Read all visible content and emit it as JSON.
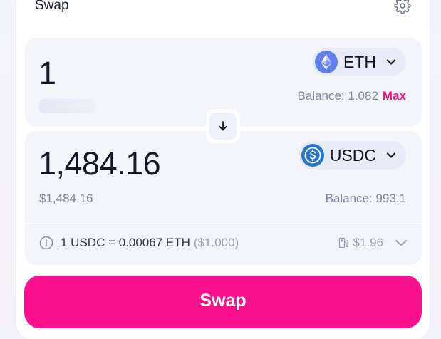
{
  "header": {
    "title": "Swap",
    "settings_icon": "gear-icon"
  },
  "sell": {
    "amount": "1",
    "token": "ETH",
    "token_icon": "ethereum-icon",
    "balance": "Balance: 1.082",
    "max_label": "Max"
  },
  "switch_icon": "arrow-down-icon",
  "buy": {
    "amount": "1,484.16",
    "fiat": "$1,484.16",
    "token": "USDC",
    "token_icon": "usdc-icon",
    "balance": "Balance: 993.1"
  },
  "rate": {
    "text": "1 USDC = 0.00067 ETH",
    "usd": "($1.000)",
    "gas": "$1.96",
    "info_icon": "info-icon",
    "gas_icon": "gas-pump-icon"
  },
  "swap_button": "Swap",
  "colors": {
    "accent": "#fb118e",
    "max": "#f0167f",
    "eth": "#627eea",
    "usdc": "#2775ca"
  }
}
